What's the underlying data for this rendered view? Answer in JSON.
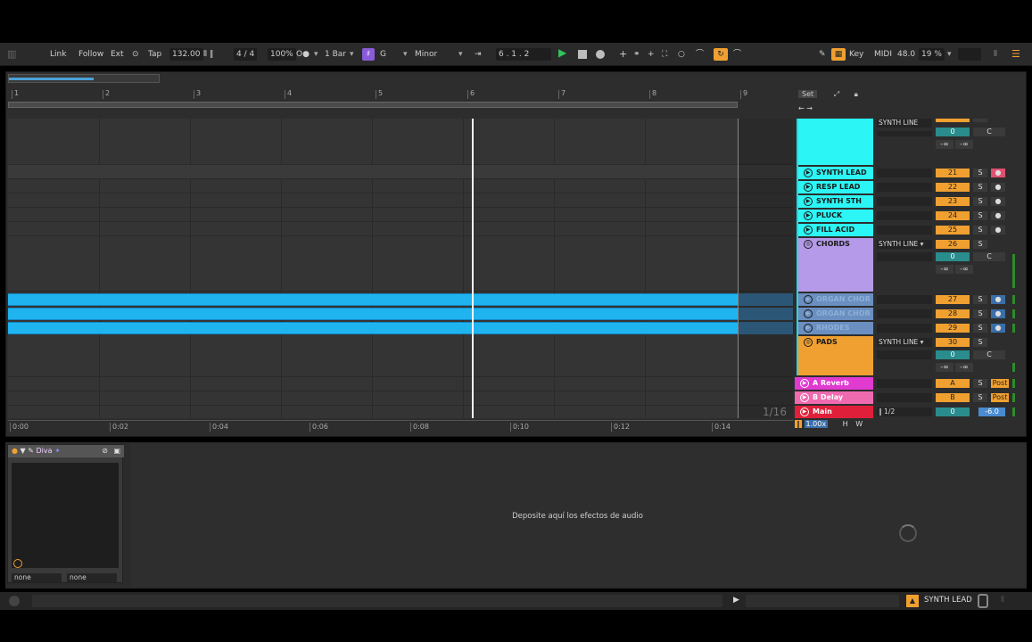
{
  "transport": {
    "link": "Link",
    "follow": "Follow",
    "ext": "Ext",
    "tap": "Tap",
    "tempo": "132.00",
    "time_sig_num": "4",
    "time_sig_sep": "/",
    "time_sig_den": "4",
    "zoom": "100%",
    "metro": "O●",
    "quantize": "1 Bar",
    "key": "G",
    "scale": "Minor",
    "position": "6 .   1 .   2",
    "draw_label": "Key",
    "midi_label": "MIDI",
    "sample_rate": "48.0",
    "cpu": "19 %"
  },
  "icons": {
    "play": "▶",
    "tap": "⊙",
    "menu": "☰"
  },
  "ruler": {
    "bars": [
      "1",
      "2",
      "3",
      "4",
      "5",
      "6",
      "7",
      "8",
      "9"
    ]
  },
  "timeline": {
    "times": [
      "0:00",
      "0:02",
      "0:04",
      "0:06",
      "0:08",
      "0:10",
      "0:12",
      "0:14"
    ]
  },
  "grid_quant": "1/16",
  "set_label": "Set",
  "tracks": {
    "group_leads_io": "SYNTH LINE",
    "group_leads_vol": "0",
    "group_leads_pan": "C",
    "group_leads_inf1": "-∞",
    "group_leads_inf2": "-∞",
    "synth_lead": {
      "name": "SYNTH LEAD",
      "num": "21",
      "s": "S"
    },
    "resp_lead": {
      "name": "RESP LEAD",
      "num": "22",
      "s": "S"
    },
    "synth_5th": {
      "name": "SYNTH 5TH",
      "num": "23",
      "s": "S"
    },
    "pluck": {
      "name": "PLUCK",
      "num": "24",
      "s": "S"
    },
    "fill_acid": {
      "name": "FILL ACID",
      "num": "25",
      "s": "S"
    },
    "chords": {
      "name": "CHORDS",
      "io": "SYNTH LINE ▾",
      "num": "26",
      "s": "S",
      "vol": "0",
      "pan": "C",
      "inf1": "-∞",
      "inf2": "-∞"
    },
    "organ_chor1": {
      "name": "ORGAN CHOR",
      "num": "27",
      "s": "S"
    },
    "organ_chor2": {
      "name": "ORGAN CHOR",
      "num": "28",
      "s": "S"
    },
    "rhodes": {
      "name": "RHODES",
      "num": "29",
      "s": "S"
    },
    "pads": {
      "name": "PADS",
      "io": "SYNTH LINE ▾",
      "num": "30",
      "s": "S",
      "vol": "0",
      "pan": "C",
      "inf1": "-∞",
      "inf2": "-∞"
    },
    "a_reverb": {
      "name": "A Reverb",
      "num": "A",
      "s": "S",
      "post": "Post"
    },
    "b_delay": {
      "name": "B Delay",
      "num": "B",
      "s": "S",
      "post": "Post"
    },
    "main": {
      "name": "Main",
      "io": "1/2",
      "num": "0",
      "vol": "-6.0"
    }
  },
  "mixer_footer": {
    "zoom": "1.00x",
    "h": "H",
    "w": "W"
  },
  "device": {
    "name": "Diva",
    "sel1": "none",
    "sel2": "none"
  },
  "dropzone_text": "Deposite aquí los efectos de audio",
  "status": {
    "track_name": "SYNTH LEAD"
  }
}
